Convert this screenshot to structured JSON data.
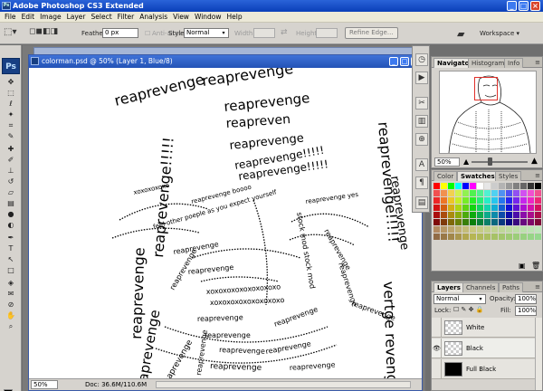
{
  "window": {
    "title": "Adobe Photoshop CS3 Extended"
  },
  "menu": [
    "File",
    "Edit",
    "Image",
    "Layer",
    "Select",
    "Filter",
    "Analysis",
    "View",
    "Window",
    "Help"
  ],
  "options": {
    "feather_label": "Feather:",
    "feather_value": "0 px",
    "antialias_label": "Anti-alias",
    "style_label": "Style:",
    "style_value": "Normal",
    "width_label": "Width:",
    "height_label": "Height:",
    "refine_label": "Refine Edge...",
    "workspace_label": "Workspace"
  },
  "tools": {
    "logo": "Ps"
  },
  "documents": {
    "back_title": "",
    "active_title": "colorman.psd @ 50% (Layer 1, Blue/8)",
    "zoom": "50%",
    "doc_info": "Doc: 36.6M/110.6M"
  },
  "artwork": {
    "words": [
      "reaprevenge",
      "reaprevenge!!!!!",
      "reapreven",
      "xoxoxoxoxo",
      "reaprevenge yes",
      "reaprevenge boooo",
      "feel other poeple as you expect yourself",
      "xoxoxoxoxoxoxoxoxo",
      "stock mod stock mod",
      "vertge revenge"
    ]
  },
  "navigator": {
    "tabs": [
      "Navigator",
      "Histogram",
      "Info"
    ],
    "zoom": "50%"
  },
  "swatches_panel": {
    "tabs": [
      "Color",
      "Swatches",
      "Styles"
    ]
  },
  "layers_panel": {
    "tabs": [
      "Layers",
      "Channels",
      "Paths"
    ],
    "blend_mode": "Normal",
    "opacity_label": "Opacity:",
    "opacity_value": "100%",
    "lock_label": "Lock:",
    "fill_label": "Fill:",
    "fill_value": "100%",
    "layers": [
      {
        "name": "White",
        "visible": false,
        "thumb": "checker"
      },
      {
        "name": "Black",
        "visible": true,
        "thumb": "checker"
      },
      {
        "name": "Full Black",
        "visible": false,
        "thumb": "black"
      }
    ]
  },
  "colors": {
    "titlebar": "#0a3fb8",
    "panel_bg": "#d6d3ce",
    "nav_frame": "#e0302a"
  }
}
